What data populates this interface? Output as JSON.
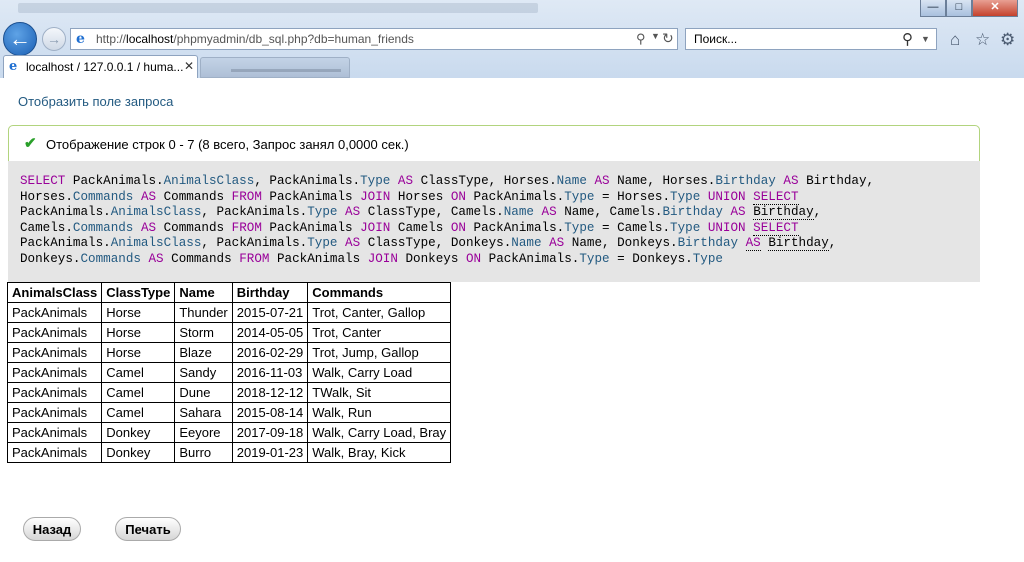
{
  "browser": {
    "address_host": "localhost",
    "address_path": "/phpmyadmin/db_sql.php?db=human_friends",
    "address_scheme": "http://",
    "search_placeholder": "Поиск...",
    "tab_title": "localhost / 127.0.0.1 / huma..."
  },
  "page": {
    "show_query_link": "Отобразить поле запроса",
    "success_message": "Отображение строк 0 - 7 (8 всего, Запрос занял 0,0000 сек.)",
    "back_button": "Назад",
    "print_button": "Печать"
  },
  "sql_lines": [
    [
      [
        "kw",
        "SELECT"
      ],
      [
        "t",
        " PackAnimals."
      ],
      [
        "fn",
        "AnimalsClass"
      ],
      [
        "t",
        ", PackAnimals."
      ],
      [
        "fn",
        "Type"
      ],
      [
        "t",
        " "
      ],
      [
        "kw",
        "AS"
      ],
      [
        "t",
        " ClassType, Horses."
      ],
      [
        "fn",
        "Name"
      ],
      [
        "t",
        " "
      ],
      [
        "kw",
        "AS"
      ],
      [
        "t",
        " Name, Horses."
      ],
      [
        "fn",
        "Birthday"
      ],
      [
        "t",
        " "
      ],
      [
        "kw",
        "AS"
      ],
      [
        "t",
        " Birthday,"
      ]
    ],
    [
      [
        "t",
        "Horses."
      ],
      [
        "fn",
        "Commands"
      ],
      [
        "t",
        " "
      ],
      [
        "kw",
        "AS"
      ],
      [
        "t",
        " Commands "
      ],
      [
        "kw",
        "FROM"
      ],
      [
        "t",
        " PackAnimals "
      ],
      [
        "kw",
        "JOIN"
      ],
      [
        "t",
        " Horses "
      ],
      [
        "kw",
        "ON"
      ],
      [
        "t",
        " PackAnimals."
      ],
      [
        "fn",
        "Type"
      ],
      [
        "t",
        " = Horses."
      ],
      [
        "fn",
        "Type"
      ],
      [
        "t",
        " "
      ],
      [
        "kw",
        "UNION"
      ],
      [
        "t",
        " "
      ],
      [
        "kwu",
        "SELECT"
      ]
    ],
    [
      [
        "t",
        "PackAnimals."
      ],
      [
        "fn",
        "AnimalsClass"
      ],
      [
        "t",
        ", PackAnimals."
      ],
      [
        "fn",
        "Type"
      ],
      [
        "t",
        " "
      ],
      [
        "kw",
        "AS"
      ],
      [
        "t",
        " ClassType, Camels."
      ],
      [
        "fn",
        "Name"
      ],
      [
        "t",
        " "
      ],
      [
        "kw",
        "AS"
      ],
      [
        "t",
        " Name, Camels."
      ],
      [
        "fn",
        "Birthday"
      ],
      [
        "t",
        " "
      ],
      [
        "kw",
        "AS"
      ],
      [
        "t",
        " "
      ],
      [
        "tu",
        "Birthday"
      ],
      [
        "t",
        ","
      ]
    ],
    [
      [
        "t",
        "Camels."
      ],
      [
        "fn",
        "Commands"
      ],
      [
        "t",
        " "
      ],
      [
        "kw",
        "AS"
      ],
      [
        "t",
        " Commands "
      ],
      [
        "kw",
        "FROM"
      ],
      [
        "t",
        " PackAnimals "
      ],
      [
        "kw",
        "JOIN"
      ],
      [
        "t",
        " Camels "
      ],
      [
        "kw",
        "ON"
      ],
      [
        "t",
        " PackAnimals."
      ],
      [
        "fn",
        "Type"
      ],
      [
        "t",
        " = Camels."
      ],
      [
        "fn",
        "Type"
      ],
      [
        "t",
        " "
      ],
      [
        "kw",
        "UNION"
      ],
      [
        "t",
        " "
      ],
      [
        "kwu",
        "SELECT"
      ]
    ],
    [
      [
        "t",
        "PackAnimals."
      ],
      [
        "fn",
        "AnimalsClass"
      ],
      [
        "t",
        ", PackAnimals."
      ],
      [
        "fn",
        "Type"
      ],
      [
        "t",
        " "
      ],
      [
        "kw",
        "AS"
      ],
      [
        "t",
        " ClassType, Donkeys."
      ],
      [
        "fn",
        "Name"
      ],
      [
        "t",
        " "
      ],
      [
        "kw",
        "AS"
      ],
      [
        "t",
        " Name, Donkeys."
      ],
      [
        "fn",
        "Birthday"
      ],
      [
        "t",
        " "
      ],
      [
        "kwu",
        "AS"
      ],
      [
        "t",
        " "
      ],
      [
        "tu",
        "Birthday"
      ],
      [
        "t",
        ","
      ]
    ],
    [
      [
        "t",
        "Donkeys."
      ],
      [
        "fn",
        "Commands"
      ],
      [
        "t",
        " "
      ],
      [
        "kw",
        "AS"
      ],
      [
        "t",
        " Commands "
      ],
      [
        "kw",
        "FROM"
      ],
      [
        "t",
        " PackAnimals "
      ],
      [
        "kw",
        "JOIN"
      ],
      [
        "t",
        " Donkeys "
      ],
      [
        "kw",
        "ON"
      ],
      [
        "t",
        " PackAnimals."
      ],
      [
        "fn",
        "Type"
      ],
      [
        "t",
        " = Donkeys."
      ],
      [
        "fn",
        "Type"
      ]
    ]
  ],
  "table": {
    "columns": [
      "AnimalsClass",
      "ClassType",
      "Name",
      "Birthday",
      "Commands"
    ],
    "rows": [
      [
        "PackAnimals",
        "Horse",
        "Thunder",
        "2015-07-21",
        "Trot, Canter, Gallop"
      ],
      [
        "PackAnimals",
        "Horse",
        "Storm",
        "2014-05-05",
        "Trot, Canter"
      ],
      [
        "PackAnimals",
        "Horse",
        "Blaze",
        "2016-02-29",
        "Trot, Jump, Gallop"
      ],
      [
        "PackAnimals",
        "Camel",
        "Sandy",
        "2016-11-03",
        "Walk, Carry Load"
      ],
      [
        "PackAnimals",
        "Camel",
        "Dune",
        "2018-12-12",
        "TWalk, Sit"
      ],
      [
        "PackAnimals",
        "Camel",
        "Sahara",
        "2015-08-14",
        "Walk, Run"
      ],
      [
        "PackAnimals",
        "Donkey",
        "Eeyore",
        "2017-09-18",
        "Walk, Carry Load, Bray"
      ],
      [
        "PackAnimals",
        "Donkey",
        "Burro",
        "2019-01-23",
        "Walk, Bray, Kick"
      ]
    ]
  },
  "icons": {
    "back": "back-arrow-icon",
    "forward": "forward-arrow-icon",
    "refresh": "refresh-icon",
    "home": "home-icon",
    "favorites": "star-icon",
    "tools": "gear-icon",
    "success": "check-icon"
  },
  "colors": {
    "link": "#235a81",
    "keyword": "#990099",
    "success_border": "#b2d47e",
    "sql_background": "#e5e5e5"
  }
}
